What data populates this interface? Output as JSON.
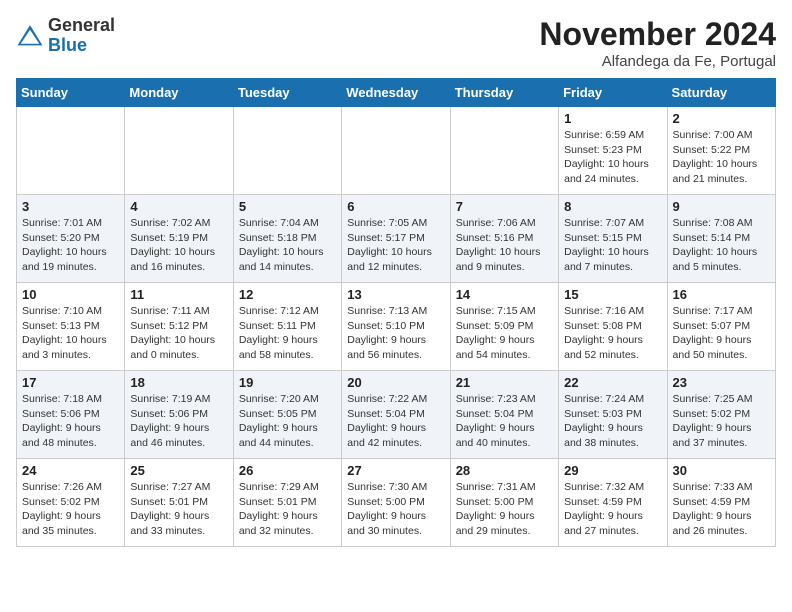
{
  "logo": {
    "general": "General",
    "blue": "Blue"
  },
  "header": {
    "month": "November 2024",
    "location": "Alfandega da Fe, Portugal"
  },
  "weekdays": [
    "Sunday",
    "Monday",
    "Tuesday",
    "Wednesday",
    "Thursday",
    "Friday",
    "Saturday"
  ],
  "weeks": [
    [
      {
        "day": "",
        "detail": ""
      },
      {
        "day": "",
        "detail": ""
      },
      {
        "day": "",
        "detail": ""
      },
      {
        "day": "",
        "detail": ""
      },
      {
        "day": "",
        "detail": ""
      },
      {
        "day": "1",
        "detail": "Sunrise: 6:59 AM\nSunset: 5:23 PM\nDaylight: 10 hours and 24 minutes."
      },
      {
        "day": "2",
        "detail": "Sunrise: 7:00 AM\nSunset: 5:22 PM\nDaylight: 10 hours and 21 minutes."
      }
    ],
    [
      {
        "day": "3",
        "detail": "Sunrise: 7:01 AM\nSunset: 5:20 PM\nDaylight: 10 hours and 19 minutes."
      },
      {
        "day": "4",
        "detail": "Sunrise: 7:02 AM\nSunset: 5:19 PM\nDaylight: 10 hours and 16 minutes."
      },
      {
        "day": "5",
        "detail": "Sunrise: 7:04 AM\nSunset: 5:18 PM\nDaylight: 10 hours and 14 minutes."
      },
      {
        "day": "6",
        "detail": "Sunrise: 7:05 AM\nSunset: 5:17 PM\nDaylight: 10 hours and 12 minutes."
      },
      {
        "day": "7",
        "detail": "Sunrise: 7:06 AM\nSunset: 5:16 PM\nDaylight: 10 hours and 9 minutes."
      },
      {
        "day": "8",
        "detail": "Sunrise: 7:07 AM\nSunset: 5:15 PM\nDaylight: 10 hours and 7 minutes."
      },
      {
        "day": "9",
        "detail": "Sunrise: 7:08 AM\nSunset: 5:14 PM\nDaylight: 10 hours and 5 minutes."
      }
    ],
    [
      {
        "day": "10",
        "detail": "Sunrise: 7:10 AM\nSunset: 5:13 PM\nDaylight: 10 hours and 3 minutes."
      },
      {
        "day": "11",
        "detail": "Sunrise: 7:11 AM\nSunset: 5:12 PM\nDaylight: 10 hours and 0 minutes."
      },
      {
        "day": "12",
        "detail": "Sunrise: 7:12 AM\nSunset: 5:11 PM\nDaylight: 9 hours and 58 minutes."
      },
      {
        "day": "13",
        "detail": "Sunrise: 7:13 AM\nSunset: 5:10 PM\nDaylight: 9 hours and 56 minutes."
      },
      {
        "day": "14",
        "detail": "Sunrise: 7:15 AM\nSunset: 5:09 PM\nDaylight: 9 hours and 54 minutes."
      },
      {
        "day": "15",
        "detail": "Sunrise: 7:16 AM\nSunset: 5:08 PM\nDaylight: 9 hours and 52 minutes."
      },
      {
        "day": "16",
        "detail": "Sunrise: 7:17 AM\nSunset: 5:07 PM\nDaylight: 9 hours and 50 minutes."
      }
    ],
    [
      {
        "day": "17",
        "detail": "Sunrise: 7:18 AM\nSunset: 5:06 PM\nDaylight: 9 hours and 48 minutes."
      },
      {
        "day": "18",
        "detail": "Sunrise: 7:19 AM\nSunset: 5:06 PM\nDaylight: 9 hours and 46 minutes."
      },
      {
        "day": "19",
        "detail": "Sunrise: 7:20 AM\nSunset: 5:05 PM\nDaylight: 9 hours and 44 minutes."
      },
      {
        "day": "20",
        "detail": "Sunrise: 7:22 AM\nSunset: 5:04 PM\nDaylight: 9 hours and 42 minutes."
      },
      {
        "day": "21",
        "detail": "Sunrise: 7:23 AM\nSunset: 5:04 PM\nDaylight: 9 hours and 40 minutes."
      },
      {
        "day": "22",
        "detail": "Sunrise: 7:24 AM\nSunset: 5:03 PM\nDaylight: 9 hours and 38 minutes."
      },
      {
        "day": "23",
        "detail": "Sunrise: 7:25 AM\nSunset: 5:02 PM\nDaylight: 9 hours and 37 minutes."
      }
    ],
    [
      {
        "day": "24",
        "detail": "Sunrise: 7:26 AM\nSunset: 5:02 PM\nDaylight: 9 hours and 35 minutes."
      },
      {
        "day": "25",
        "detail": "Sunrise: 7:27 AM\nSunset: 5:01 PM\nDaylight: 9 hours and 33 minutes."
      },
      {
        "day": "26",
        "detail": "Sunrise: 7:29 AM\nSunset: 5:01 PM\nDaylight: 9 hours and 32 minutes."
      },
      {
        "day": "27",
        "detail": "Sunrise: 7:30 AM\nSunset: 5:00 PM\nDaylight: 9 hours and 30 minutes."
      },
      {
        "day": "28",
        "detail": "Sunrise: 7:31 AM\nSunset: 5:00 PM\nDaylight: 9 hours and 29 minutes."
      },
      {
        "day": "29",
        "detail": "Sunrise: 7:32 AM\nSunset: 4:59 PM\nDaylight: 9 hours and 27 minutes."
      },
      {
        "day": "30",
        "detail": "Sunrise: 7:33 AM\nSunset: 4:59 PM\nDaylight: 9 hours and 26 minutes."
      }
    ]
  ]
}
